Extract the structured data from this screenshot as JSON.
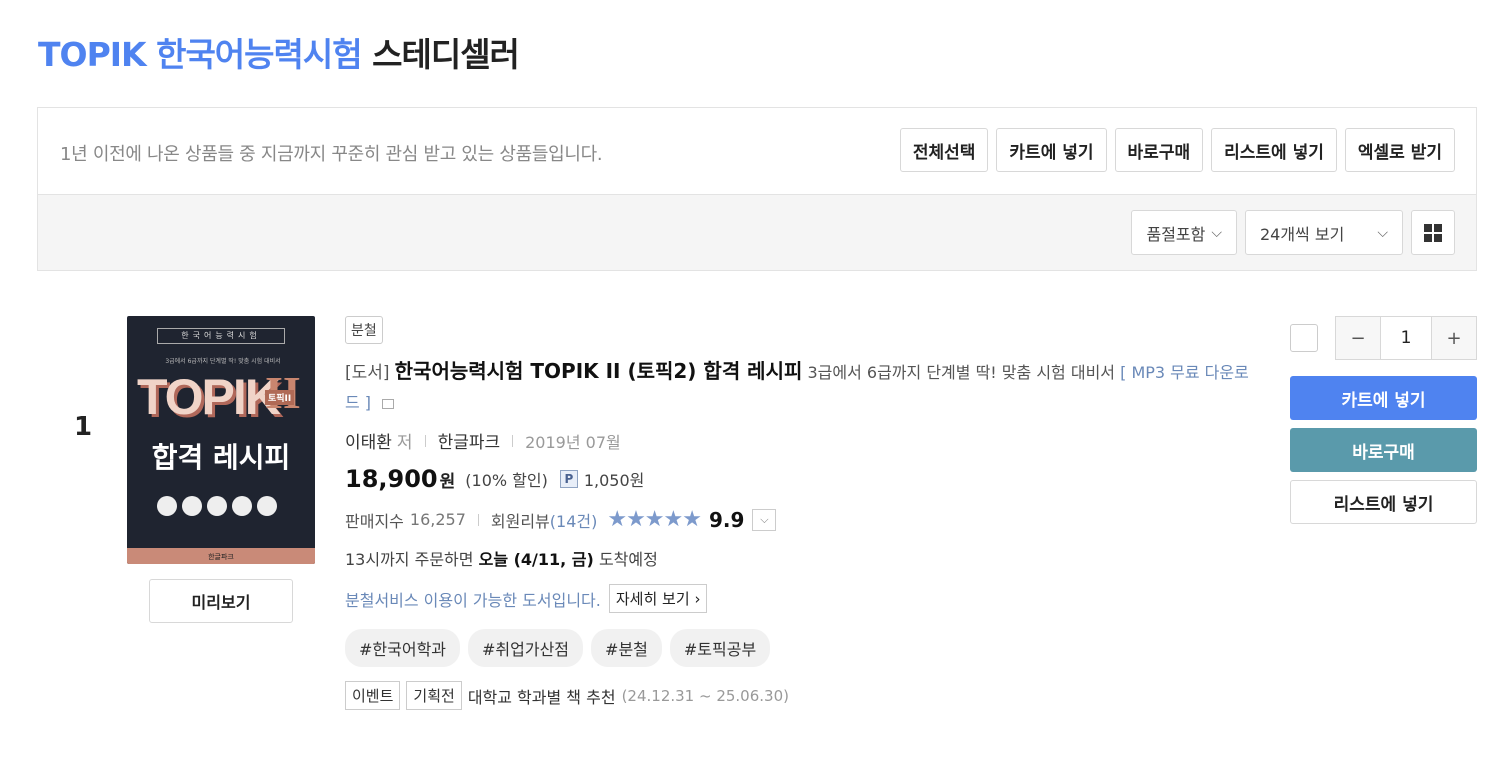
{
  "header": {
    "title_accent": "TOPIK 한국어능력시험",
    "title_rest": "스테디셀러"
  },
  "toolbar": {
    "description": "1년 이전에 나온 상품들 중 지금까지 꾸준히 관심 받고 있는 상품들입니다.",
    "buttons": [
      "전체선택",
      "카트에 넣기",
      "바로구매",
      "리스트에 넣기",
      "엑셀로 받기"
    ],
    "filter_label": "품절포함",
    "view_count": "24개씩 보기"
  },
  "product": {
    "rank": "1",
    "badge": "분철",
    "category": "[도서]",
    "name": "한국어능력시험 TOPIK II (토픽2) 합격 레시피",
    "subtitle": "3급에서 6급까지 단계별 딱! 맞춤 시험 대비서",
    "mp3": "[ MP3 무료 다운로드 ]",
    "author": "이태환",
    "author_role": "저",
    "publisher": "한글파크",
    "date": "2019년 07월",
    "price": "18,900",
    "won": "원",
    "discount": "(10% 할인)",
    "points_icon": "P",
    "points": "1,050원",
    "sales_label": "판매지수",
    "sales_value": "16,257",
    "review_label": "회원리뷰",
    "review_count": "(14건)",
    "rating": "9.9",
    "stars": "★★★★★",
    "delivery_prefix": "13시까지 주문하면",
    "delivery_bold": "오늘 (4/11, 금)",
    "delivery_suffix": "도착예정",
    "split_text": "분철서비스 이용이 가능한 도서입니다.",
    "detail_label": "자세히 보기",
    "tags": [
      "#한국어학과",
      "#취업가산점",
      "#분철",
      "#토픽공부"
    ],
    "event_badges": [
      "이벤트",
      "기획전"
    ],
    "event_text": "대학교 학과별 책 추천",
    "event_period": "(24.12.31 ~ 25.06.30)",
    "preview_label": "미리보기",
    "quantity": "1"
  },
  "cover": {
    "top_text": "한국어능력시험",
    "sub_text": "3급에서 6급까지 단계별 딱! 맞춤 시험 대비서",
    "logo": "TOPIK",
    "roman": "II",
    "tag": "토픽II",
    "title": "합격 레시피",
    "publisher": "한글파크"
  },
  "actions": {
    "minus": "−",
    "plus": "+",
    "cart": "카트에 넣기",
    "buy": "바로구매",
    "list": "리스트에 넣기"
  },
  "colors": {
    "accent": "#4f83f0",
    "buy": "#5a9aab",
    "link": "#6a89b8"
  }
}
